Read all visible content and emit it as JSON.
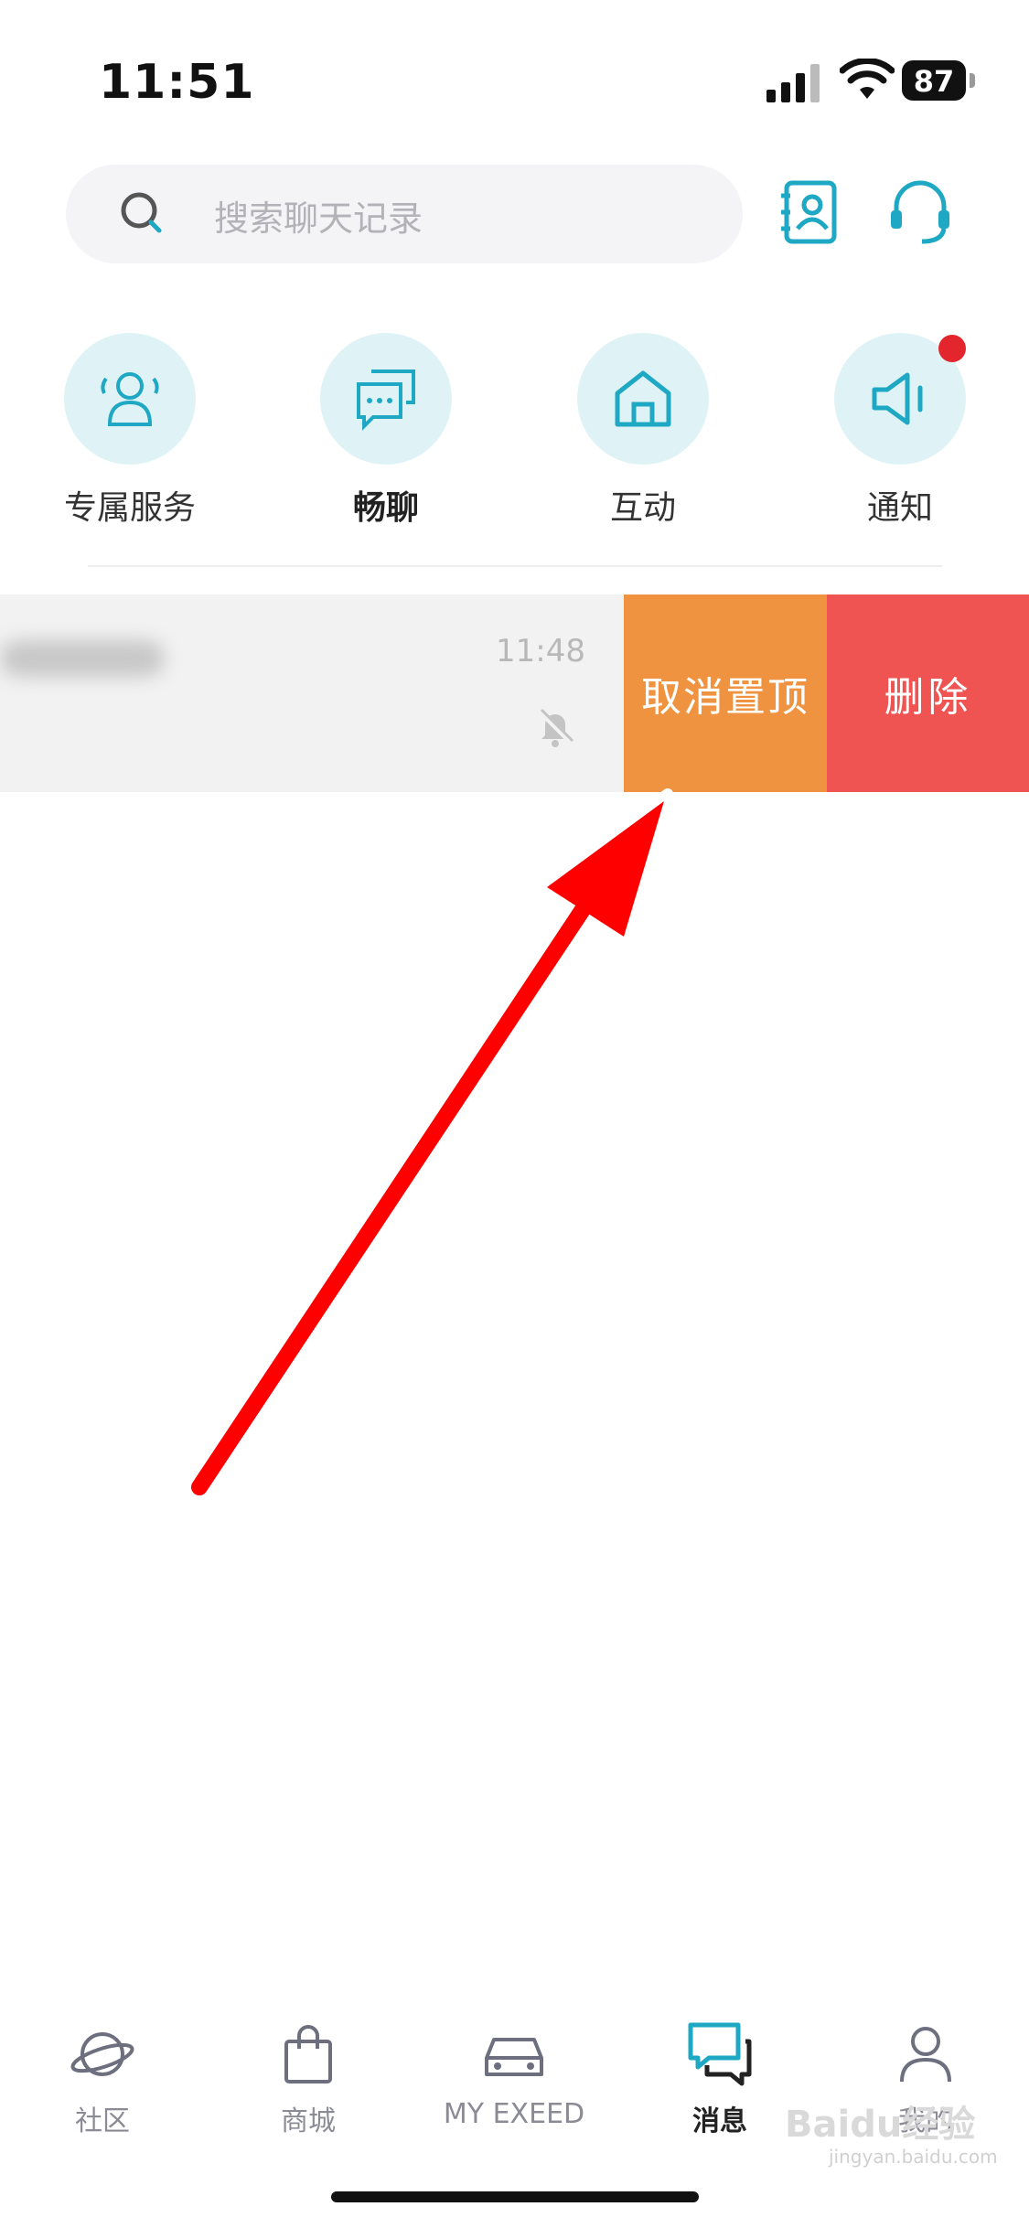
{
  "status_bar": {
    "time": "11:51",
    "battery": "87"
  },
  "search": {
    "placeholder": "搜索聊天记录"
  },
  "quick_entries": [
    {
      "label": "专属服务",
      "icon": "users-icon"
    },
    {
      "label": "畅聊",
      "icon": "chat-bubbles-icon"
    },
    {
      "label": "互动",
      "icon": "home-icon"
    },
    {
      "label": "通知",
      "icon": "speaker-icon",
      "has_badge": true
    }
  ],
  "conversation": {
    "time": "11:48",
    "muted": true,
    "actions": {
      "unpin": "取消置顶",
      "delete": "删除"
    }
  },
  "tab_bar": [
    {
      "label": "社区",
      "icon": "planet-icon"
    },
    {
      "label": "商城",
      "icon": "shopping-bag-icon"
    },
    {
      "label": "MY EXEED",
      "icon": "car-icon"
    },
    {
      "label": "消息",
      "icon": "message-icon",
      "active": true
    },
    {
      "label": "我的",
      "icon": "person-icon"
    }
  ],
  "watermark": {
    "brand": "Baidu经验",
    "sub": "jingyan.baidu.com"
  },
  "colors": {
    "accent": "#1ea8c4",
    "unpin_bg": "#ef9340",
    "delete_bg": "#ef5352",
    "badge": "#e3262e",
    "annotation_arrow": "#ff0000"
  }
}
